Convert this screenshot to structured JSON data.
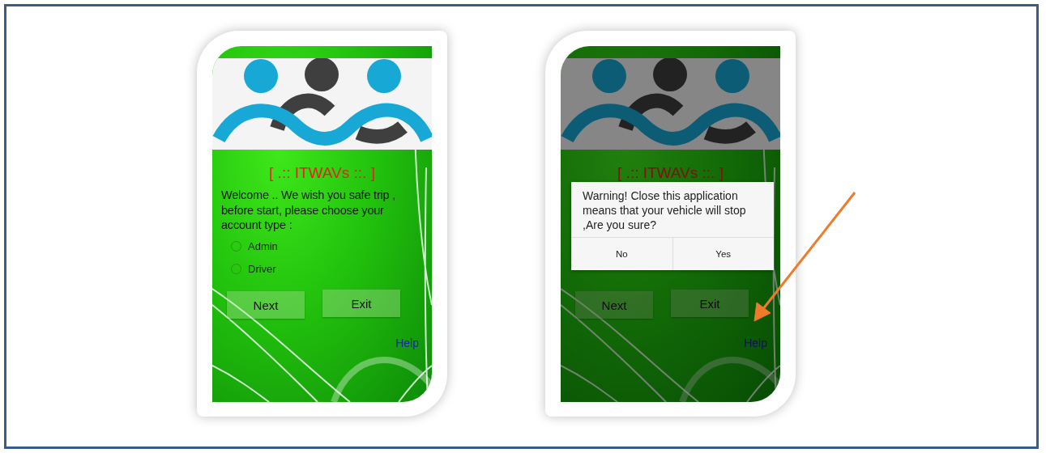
{
  "screens": [
    {
      "dimmed": false,
      "title": "[ .:: ITWAVs ::. ]",
      "message": "Welcome .. We wish you safe trip , before start, please choose your account type :",
      "options": [
        {
          "label": "Admin",
          "selected": false
        },
        {
          "label": "Driver",
          "selected": false
        }
      ],
      "buttons": [
        "Next",
        "Exit"
      ],
      "help_link": "Help"
    },
    {
      "dimmed": true,
      "title": "[ .:: ITWAVs ::. ]",
      "buttons": [
        "Next",
        "Exit"
      ],
      "help_link": "Help",
      "dialog": {
        "message": "Warning! Close this application means that your vehicle will stop ,Are you sure?",
        "buttons": [
          "No",
          "Yes"
        ]
      }
    }
  ],
  "annotation_arrow": {
    "visible": true
  }
}
